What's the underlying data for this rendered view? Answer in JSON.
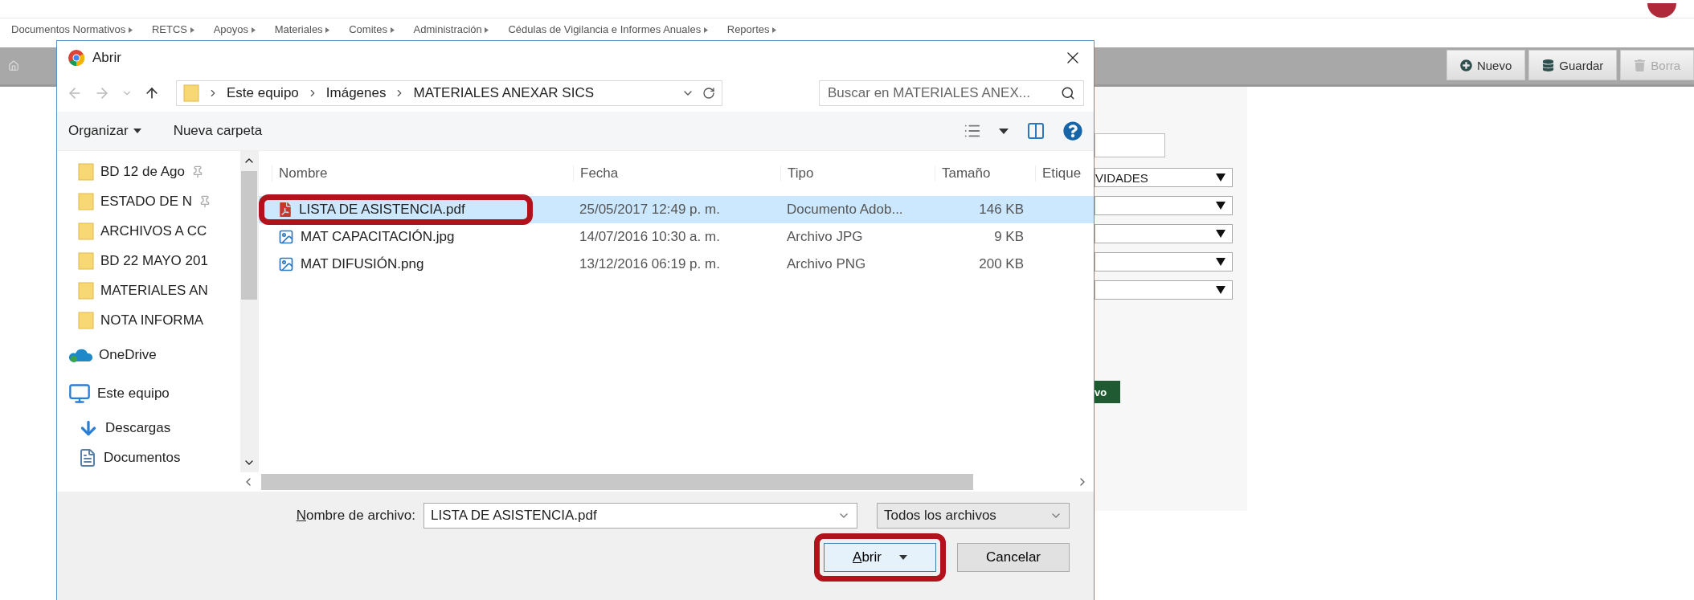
{
  "page": {
    "menu": [
      "Documentos Normativos",
      "RETCS",
      "Apoyos",
      "Materiales",
      "Comites",
      "Administración",
      "Cédulas de Vigilancia e Informes Anuales",
      "Reportes"
    ],
    "toolbar": [
      {
        "label": "Nuevo",
        "kind": "new",
        "disabled": false
      },
      {
        "label": "Guardar",
        "kind": "save",
        "disabled": false
      },
      {
        "label": "Borra",
        "kind": "delete",
        "disabled": true
      }
    ],
    "form": {
      "fields": [
        {
          "kind": "input"
        },
        {
          "kind": "select",
          "value": "VIDADES"
        },
        {
          "kind": "select"
        },
        {
          "kind": "select"
        },
        {
          "kind": "select"
        },
        {
          "kind": "select"
        }
      ],
      "button": "vo"
    }
  },
  "dialog": {
    "title": "Abrir",
    "path": [
      "Este equipo",
      "Imágenes",
      "MATERIALES ANEXAR SICS"
    ],
    "search": {
      "placeholder": "Buscar en MATERIALES ANEX..."
    },
    "commands": [
      {
        "label": "Organizar",
        "kind": "menu"
      },
      {
        "label": "Nueva carpeta",
        "kind": "button"
      }
    ],
    "nav": [
      {
        "label": "BD 12 de Ago",
        "kind": "folder",
        "pinned": true
      },
      {
        "label": "ESTADO DE N",
        "kind": "folder",
        "pinned": true
      },
      {
        "label": "ARCHIVOS A CC",
        "kind": "folder",
        "pinned": false
      },
      {
        "label": "BD 22 MAYO 201",
        "kind": "folder",
        "pinned": false
      },
      {
        "label": "MATERIALES AN",
        "kind": "folder",
        "pinned": false
      },
      {
        "label": "NOTA INFORMA",
        "kind": "folder",
        "pinned": false
      },
      {
        "label": "OneDrive",
        "kind": "cloud",
        "pinned": false
      },
      {
        "label": "Este equipo",
        "kind": "pc",
        "pinned": false
      },
      {
        "label": "Descargas",
        "kind": "downloads",
        "pinned": false
      },
      {
        "label": "Documentos",
        "kind": "documents",
        "pinned": false
      }
    ],
    "columns": [
      "Nombre",
      "Fecha",
      "Tipo",
      "Tamaño",
      "Etique"
    ],
    "files": [
      {
        "name": "LISTA DE ASISTENCIA.pdf",
        "date": "25/05/2017 12:49 p. m.",
        "type": "Documento Adob...",
        "size": "146 KB",
        "kind": "pdf",
        "selected": true,
        "annotated": true
      },
      {
        "name": "MAT CAPACITACIÓN.jpg",
        "date": "14/07/2016 10:30 a. m.",
        "type": "Archivo JPG",
        "size": "9 KB",
        "kind": "image",
        "selected": false,
        "annotated": false
      },
      {
        "name": "MAT DIFUSIÓN.png",
        "date": "13/12/2016 06:19 p. m.",
        "type": "Archivo PNG",
        "size": "200 KB",
        "kind": "image",
        "selected": false,
        "annotated": false
      }
    ],
    "filename": {
      "label_key": "N",
      "label_rest": "ombre de archivo:",
      "value": "LISTA DE ASISTENCIA.pdf"
    },
    "filter": "Todos los archivos",
    "buttons": [
      {
        "label_key": "A",
        "label_rest": "brir",
        "kind": "split",
        "annotated": true
      },
      {
        "label_rest": "Cancelar",
        "kind": "plain",
        "annotated": false
      }
    ]
  }
}
